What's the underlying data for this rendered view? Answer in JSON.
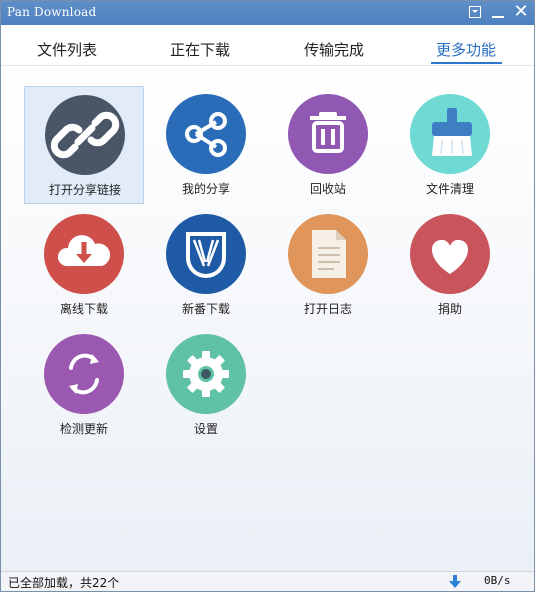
{
  "window": {
    "title": "Pan Download"
  },
  "tabs": [
    {
      "label": "文件列表"
    },
    {
      "label": "正在下载"
    },
    {
      "label": "传输完成"
    },
    {
      "label": "更多功能"
    }
  ],
  "active_tab": "更多功能",
  "tiles": [
    {
      "label": "打开分享链接",
      "icon": "link-icon",
      "color": "#4a5568"
    },
    {
      "label": "我的分享",
      "icon": "share-icon",
      "color": "#2a6cb8"
    },
    {
      "label": "回收站",
      "icon": "trash-icon",
      "color": "#9058b2"
    },
    {
      "label": "文件清理",
      "icon": "broom-icon",
      "color": "#6fd9d4"
    },
    {
      "label": "离线下载",
      "icon": "cloud-download-icon",
      "color": "#cf4f4b"
    },
    {
      "label": "新番下载",
      "icon": "wings-emblem-icon",
      "color": "#1f5aa6"
    },
    {
      "label": "打开日志",
      "icon": "document-icon",
      "color": "#e0955a"
    },
    {
      "label": "捐助",
      "icon": "heart-icon",
      "color": "#c9545b"
    },
    {
      "label": "检测更新",
      "icon": "refresh-icon",
      "color": "#9a58b0"
    },
    {
      "label": "设置",
      "icon": "gear-icon",
      "color": "#5fc2a6"
    }
  ],
  "status": {
    "text": "已全部加载，共22个",
    "speed": "0B/s",
    "arrow_icon": "download-arrow-icon",
    "arrow_color": "#2a82d6"
  }
}
